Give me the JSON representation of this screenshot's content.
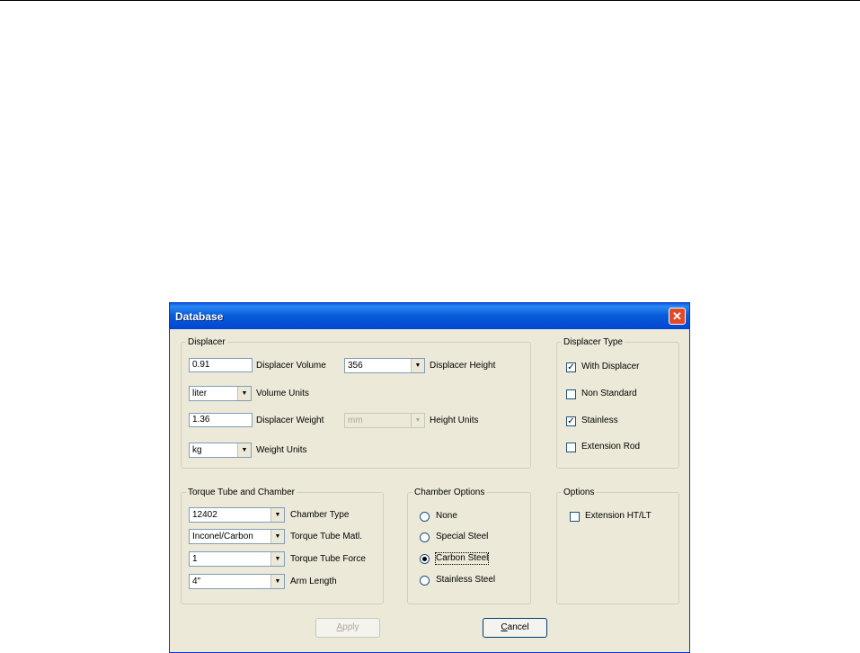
{
  "window": {
    "title": "Database"
  },
  "displacer": {
    "legend": "Displacer",
    "volume_value": "0.91",
    "volume_label": "Displacer Volume",
    "height_value": "356",
    "height_label": "Displacer Height",
    "volume_units_value": "liter",
    "volume_units_label": "Volume Units",
    "weight_value": "1.36",
    "weight_label": "Displacer Weight",
    "height_units_value": "mm",
    "height_units_label": "Height Units",
    "weight_units_value": "kg",
    "weight_units_label": "Weight Units"
  },
  "displacer_type": {
    "legend": "Displacer Type",
    "items": [
      {
        "label": "With Displacer",
        "checked": true
      },
      {
        "label": "Non Standard",
        "checked": false
      },
      {
        "label": "Stainless",
        "checked": true
      },
      {
        "label": "Extension Rod",
        "checked": false
      }
    ]
  },
  "torque": {
    "legend": "Torque Tube and Chamber",
    "chamber_type_value": "12402",
    "chamber_type_label": "Chamber Type",
    "material_value": "Inconel/Carbon",
    "material_label": "Torque Tube Matl.",
    "force_value": "1",
    "force_label": "Torque Tube Force",
    "arm_value": "4\"",
    "arm_label": "Arm Length"
  },
  "chamber_options": {
    "legend": "Chamber Options",
    "items": [
      {
        "label": "None",
        "selected": false
      },
      {
        "label": "Special Steel",
        "selected": false
      },
      {
        "label": "Carbon Steel",
        "selected": true
      },
      {
        "label": "Stainless Steel",
        "selected": false
      }
    ]
  },
  "options": {
    "legend": "Options",
    "items": [
      {
        "label": "Extension HT/LT",
        "checked": false
      }
    ]
  },
  "buttons": {
    "apply_mnemonic": "A",
    "apply_rest": "pply",
    "cancel_mnemonic": "C",
    "cancel_rest": "ancel"
  },
  "colors": {
    "title_bar": "#0a5fd8",
    "dialog_bg": "#ece9d8",
    "close_button": "#e04a2a"
  }
}
